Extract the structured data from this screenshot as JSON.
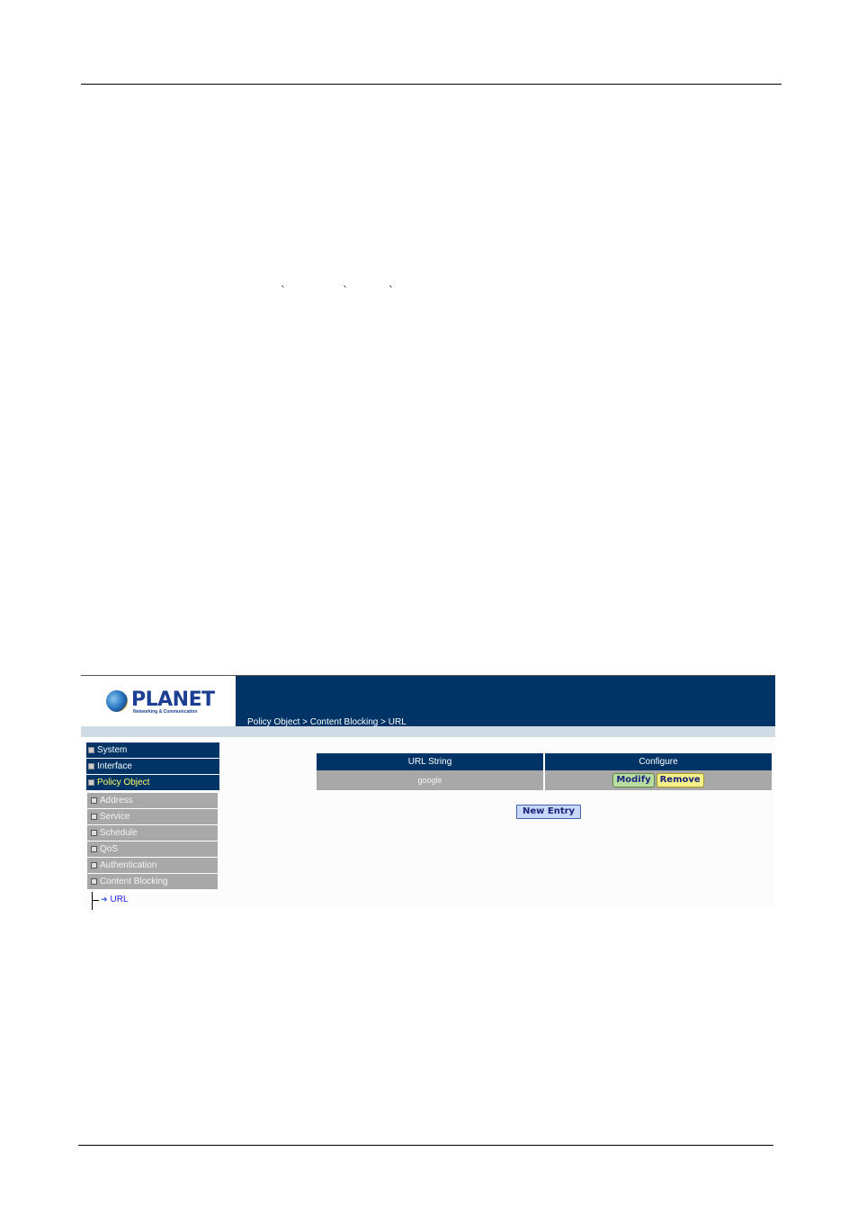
{
  "document": {
    "stray_marks": [
      "`",
      "`",
      "`"
    ]
  },
  "app": {
    "brand": "PLANET",
    "tagline": "Networking & Communication",
    "breadcrumb": "Policy Object > Content Blocking > URL"
  },
  "sidebar": {
    "main_items": [
      {
        "label": "System",
        "state": "collapsed"
      },
      {
        "label": "Interface",
        "state": "collapsed"
      },
      {
        "label": "Policy Object",
        "state": "expanded"
      }
    ],
    "sub_items": [
      {
        "label": "Address",
        "state": "collapsed"
      },
      {
        "label": "Service",
        "state": "collapsed"
      },
      {
        "label": "Schedule",
        "state": "collapsed"
      },
      {
        "label": "QoS",
        "state": "collapsed"
      },
      {
        "label": "Authentication",
        "state": "collapsed"
      },
      {
        "label": "Content Blocking",
        "state": "expanded"
      }
    ],
    "leaf": {
      "label": "URL"
    }
  },
  "table": {
    "headers": [
      "URL String",
      "Configure"
    ],
    "rows": [
      {
        "url_string": "google",
        "actions": [
          "Modify",
          "Remove"
        ]
      }
    ]
  },
  "buttons": {
    "new_entry": "New Entry"
  },
  "colors": {
    "header_bg": "#003366",
    "active_nav": "#ffff66",
    "sub_nav_bg": "#a8a8a8",
    "leaf_link": "#2222ee"
  }
}
